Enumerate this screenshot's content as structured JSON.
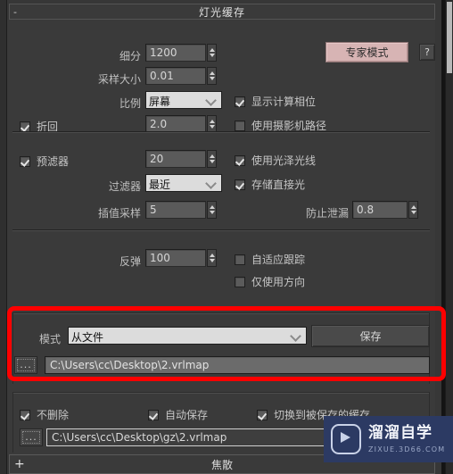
{
  "window": {
    "rollout_title": "灯光缓存",
    "collapse_marker": "-"
  },
  "expert": {
    "label": "专家模式",
    "help_label": "?",
    "color": "#d7b4b4"
  },
  "fields": {
    "subdivs_label": "细分",
    "subdivs_value": "1200",
    "sample_size_label": "采样大小",
    "sample_size_value": "0.01",
    "scale_label": "比例",
    "scale_value": "屏幕",
    "bounces_label": "折回",
    "bounces_value": "2.0",
    "prefilter_label": "预滤器",
    "prefilter_value": "20",
    "filter_label": "过滤器",
    "filter_value": "最近",
    "interp_label": "插值采样",
    "interp_value": "5",
    "leak_label": "防止泄漏",
    "leak_value": "0.8",
    "retrace_label": "反弹",
    "retrace_value": "100"
  },
  "checkboxes": {
    "show_calc_phase": "显示计算相位",
    "use_camera_path": "使用摄影机路径",
    "prefilter": "预滤器",
    "bounces": "折回",
    "use_glossy_rays": "使用光泽光线",
    "store_direct_light": "存储直接光",
    "adaptive_tracing": "自适应跟踪",
    "use_dir_only": "仅使用方向",
    "dont_delete": "不删除",
    "auto_save": "自动保存",
    "switch_to_saved": "切换到被保存的缓存"
  },
  "mode_group": {
    "mode_label": "模式",
    "mode_value": "从文件",
    "save_label": "保存",
    "browse_label": "...",
    "file_path": "C:\\Users\\cc\\Desktop\\2.vrlmap",
    "highlight_color": "#fe0000"
  },
  "autosave": {
    "browse_label": "...",
    "file_path": "C:\\Users\\cc\\Desktop\\gz\\2.vrlmap"
  },
  "bottom_rollout": {
    "title": "焦散",
    "expand_marker": "+"
  },
  "watermark": {
    "line1": "溜溜自学",
    "line2": "ZIXUE.3D66.COM"
  }
}
